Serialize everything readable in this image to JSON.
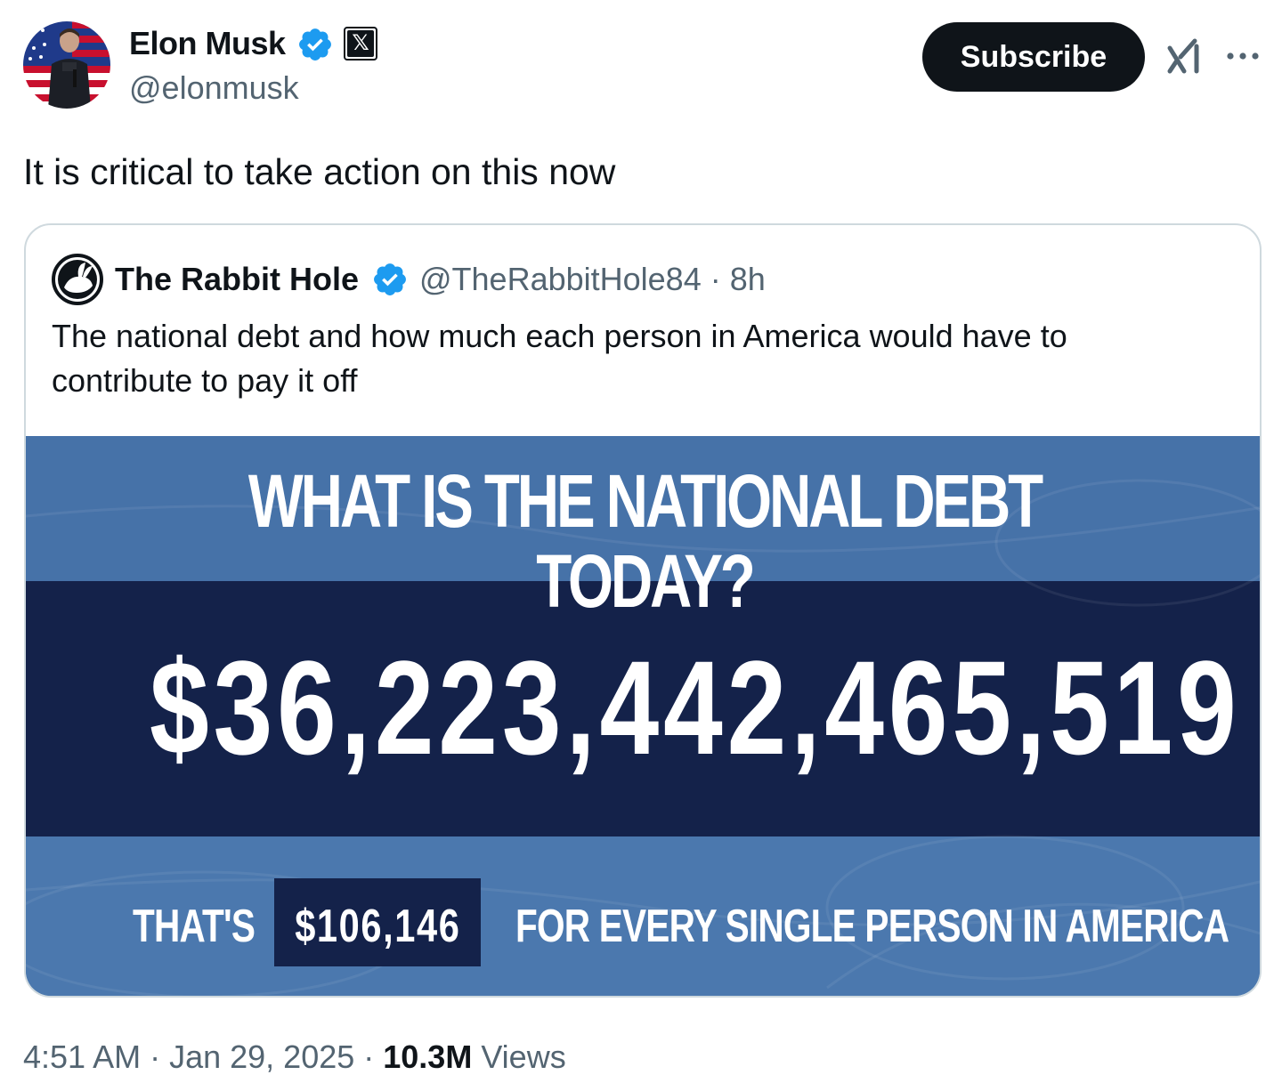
{
  "author": {
    "name": "Elon Musk",
    "handle": "@elonmusk",
    "verified": true,
    "affiliation_badge": "x-logo-icon"
  },
  "header": {
    "subscribe_label": "Subscribe",
    "grok_icon": "grok-icon",
    "more_icon": "more-dots-icon"
  },
  "tweet": {
    "text": "It is critical to take action on this now"
  },
  "quote": {
    "name": "The Rabbit Hole",
    "handle_time": "@TheRabbitHole84 · 8h",
    "verified": true,
    "text": "The national debt and how much each person in America would have to contribute to pay it off",
    "image": {
      "headline": "WHAT IS THE NATIONAL DEBT TODAY?",
      "debt_amount": "$36,223,442,465,519",
      "thats": "THAT'S",
      "per_person": "$106,146",
      "per_person_suffix": "FOR EVERY SINGLE PERSON IN AMERICA"
    }
  },
  "meta": {
    "timestamp": "4:51 AM · Jan 29, 2025 · ",
    "views_count": "10.3M",
    "views_label": " Views"
  },
  "colors": {
    "text_primary": "#0f1419",
    "text_secondary": "#536471",
    "verified_blue": "#1d9bf0",
    "border": "#cfd9de",
    "infographic_blue": "#4672a8",
    "infographic_navy": "#14224a"
  }
}
